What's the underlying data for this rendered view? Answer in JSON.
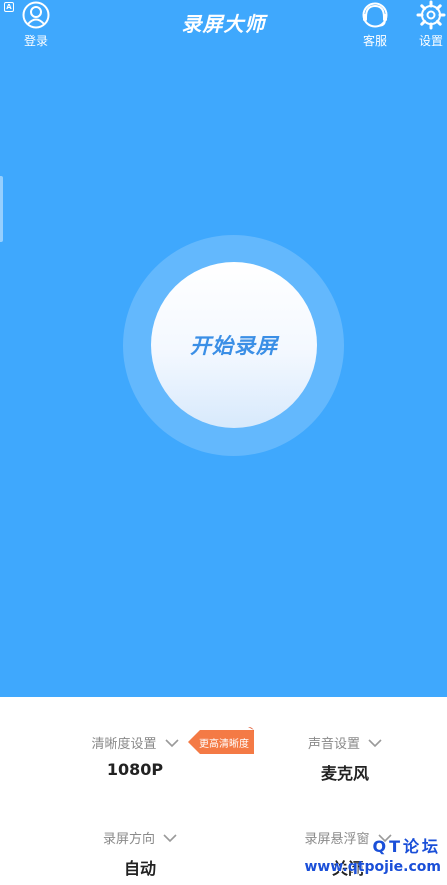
{
  "status_bar": {
    "indicator": "A"
  },
  "header": {
    "title": "录屏大师",
    "login": {
      "label": "登录",
      "icon": "user-icon"
    },
    "service": {
      "label": "客服",
      "icon": "headset-icon"
    },
    "settings": {
      "label": "设置",
      "icon": "gear-icon"
    }
  },
  "main": {
    "record_button_label": "开始录屏"
  },
  "settings_panel": {
    "quality": {
      "name": "清晰度设置",
      "value": "1080P",
      "badge": "更高清晰度"
    },
    "audio": {
      "name": "声音设置",
      "value": "麦克风"
    },
    "orientation": {
      "name": "录屏方向",
      "value": "自动"
    },
    "float_window": {
      "name": "录屏悬浮窗",
      "value": "关闭"
    }
  },
  "watermark": {
    "line1": "QT论坛",
    "line2": "www.qtpojie.com"
  },
  "colors": {
    "primary": "#3fa8fd",
    "ring": "#63b8fd",
    "button_text": "#3b8fe6",
    "badge": "#f47a45",
    "value_text": "#222222",
    "label_text": "#8a8a8a"
  }
}
